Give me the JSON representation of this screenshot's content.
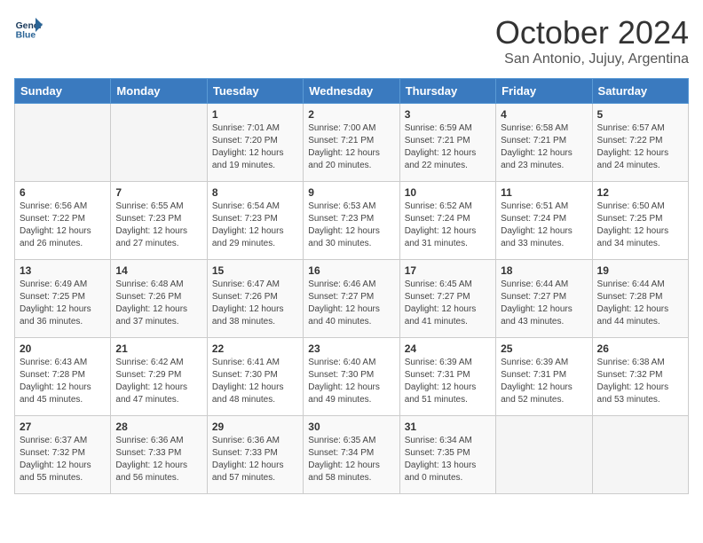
{
  "logo": {
    "line1": "General",
    "line2": "Blue"
  },
  "title": "October 2024",
  "subtitle": "San Antonio, Jujuy, Argentina",
  "days_of_week": [
    "Sunday",
    "Monday",
    "Tuesday",
    "Wednesday",
    "Thursday",
    "Friday",
    "Saturday"
  ],
  "weeks": [
    [
      {
        "day": "",
        "detail": ""
      },
      {
        "day": "",
        "detail": ""
      },
      {
        "day": "1",
        "detail": "Sunrise: 7:01 AM\nSunset: 7:20 PM\nDaylight: 12 hours\nand 19 minutes."
      },
      {
        "day": "2",
        "detail": "Sunrise: 7:00 AM\nSunset: 7:21 PM\nDaylight: 12 hours\nand 20 minutes."
      },
      {
        "day": "3",
        "detail": "Sunrise: 6:59 AM\nSunset: 7:21 PM\nDaylight: 12 hours\nand 22 minutes."
      },
      {
        "day": "4",
        "detail": "Sunrise: 6:58 AM\nSunset: 7:21 PM\nDaylight: 12 hours\nand 23 minutes."
      },
      {
        "day": "5",
        "detail": "Sunrise: 6:57 AM\nSunset: 7:22 PM\nDaylight: 12 hours\nand 24 minutes."
      }
    ],
    [
      {
        "day": "6",
        "detail": "Sunrise: 6:56 AM\nSunset: 7:22 PM\nDaylight: 12 hours\nand 26 minutes."
      },
      {
        "day": "7",
        "detail": "Sunrise: 6:55 AM\nSunset: 7:23 PM\nDaylight: 12 hours\nand 27 minutes."
      },
      {
        "day": "8",
        "detail": "Sunrise: 6:54 AM\nSunset: 7:23 PM\nDaylight: 12 hours\nand 29 minutes."
      },
      {
        "day": "9",
        "detail": "Sunrise: 6:53 AM\nSunset: 7:23 PM\nDaylight: 12 hours\nand 30 minutes."
      },
      {
        "day": "10",
        "detail": "Sunrise: 6:52 AM\nSunset: 7:24 PM\nDaylight: 12 hours\nand 31 minutes."
      },
      {
        "day": "11",
        "detail": "Sunrise: 6:51 AM\nSunset: 7:24 PM\nDaylight: 12 hours\nand 33 minutes."
      },
      {
        "day": "12",
        "detail": "Sunrise: 6:50 AM\nSunset: 7:25 PM\nDaylight: 12 hours\nand 34 minutes."
      }
    ],
    [
      {
        "day": "13",
        "detail": "Sunrise: 6:49 AM\nSunset: 7:25 PM\nDaylight: 12 hours\nand 36 minutes."
      },
      {
        "day": "14",
        "detail": "Sunrise: 6:48 AM\nSunset: 7:26 PM\nDaylight: 12 hours\nand 37 minutes."
      },
      {
        "day": "15",
        "detail": "Sunrise: 6:47 AM\nSunset: 7:26 PM\nDaylight: 12 hours\nand 38 minutes."
      },
      {
        "day": "16",
        "detail": "Sunrise: 6:46 AM\nSunset: 7:27 PM\nDaylight: 12 hours\nand 40 minutes."
      },
      {
        "day": "17",
        "detail": "Sunrise: 6:45 AM\nSunset: 7:27 PM\nDaylight: 12 hours\nand 41 minutes."
      },
      {
        "day": "18",
        "detail": "Sunrise: 6:44 AM\nSunset: 7:27 PM\nDaylight: 12 hours\nand 43 minutes."
      },
      {
        "day": "19",
        "detail": "Sunrise: 6:44 AM\nSunset: 7:28 PM\nDaylight: 12 hours\nand 44 minutes."
      }
    ],
    [
      {
        "day": "20",
        "detail": "Sunrise: 6:43 AM\nSunset: 7:28 PM\nDaylight: 12 hours\nand 45 minutes."
      },
      {
        "day": "21",
        "detail": "Sunrise: 6:42 AM\nSunset: 7:29 PM\nDaylight: 12 hours\nand 47 minutes."
      },
      {
        "day": "22",
        "detail": "Sunrise: 6:41 AM\nSunset: 7:30 PM\nDaylight: 12 hours\nand 48 minutes."
      },
      {
        "day": "23",
        "detail": "Sunrise: 6:40 AM\nSunset: 7:30 PM\nDaylight: 12 hours\nand 49 minutes."
      },
      {
        "day": "24",
        "detail": "Sunrise: 6:39 AM\nSunset: 7:31 PM\nDaylight: 12 hours\nand 51 minutes."
      },
      {
        "day": "25",
        "detail": "Sunrise: 6:39 AM\nSunset: 7:31 PM\nDaylight: 12 hours\nand 52 minutes."
      },
      {
        "day": "26",
        "detail": "Sunrise: 6:38 AM\nSunset: 7:32 PM\nDaylight: 12 hours\nand 53 minutes."
      }
    ],
    [
      {
        "day": "27",
        "detail": "Sunrise: 6:37 AM\nSunset: 7:32 PM\nDaylight: 12 hours\nand 55 minutes."
      },
      {
        "day": "28",
        "detail": "Sunrise: 6:36 AM\nSunset: 7:33 PM\nDaylight: 12 hours\nand 56 minutes."
      },
      {
        "day": "29",
        "detail": "Sunrise: 6:36 AM\nSunset: 7:33 PM\nDaylight: 12 hours\nand 57 minutes."
      },
      {
        "day": "30",
        "detail": "Sunrise: 6:35 AM\nSunset: 7:34 PM\nDaylight: 12 hours\nand 58 minutes."
      },
      {
        "day": "31",
        "detail": "Sunrise: 6:34 AM\nSunset: 7:35 PM\nDaylight: 13 hours\nand 0 minutes."
      },
      {
        "day": "",
        "detail": ""
      },
      {
        "day": "",
        "detail": ""
      }
    ]
  ]
}
